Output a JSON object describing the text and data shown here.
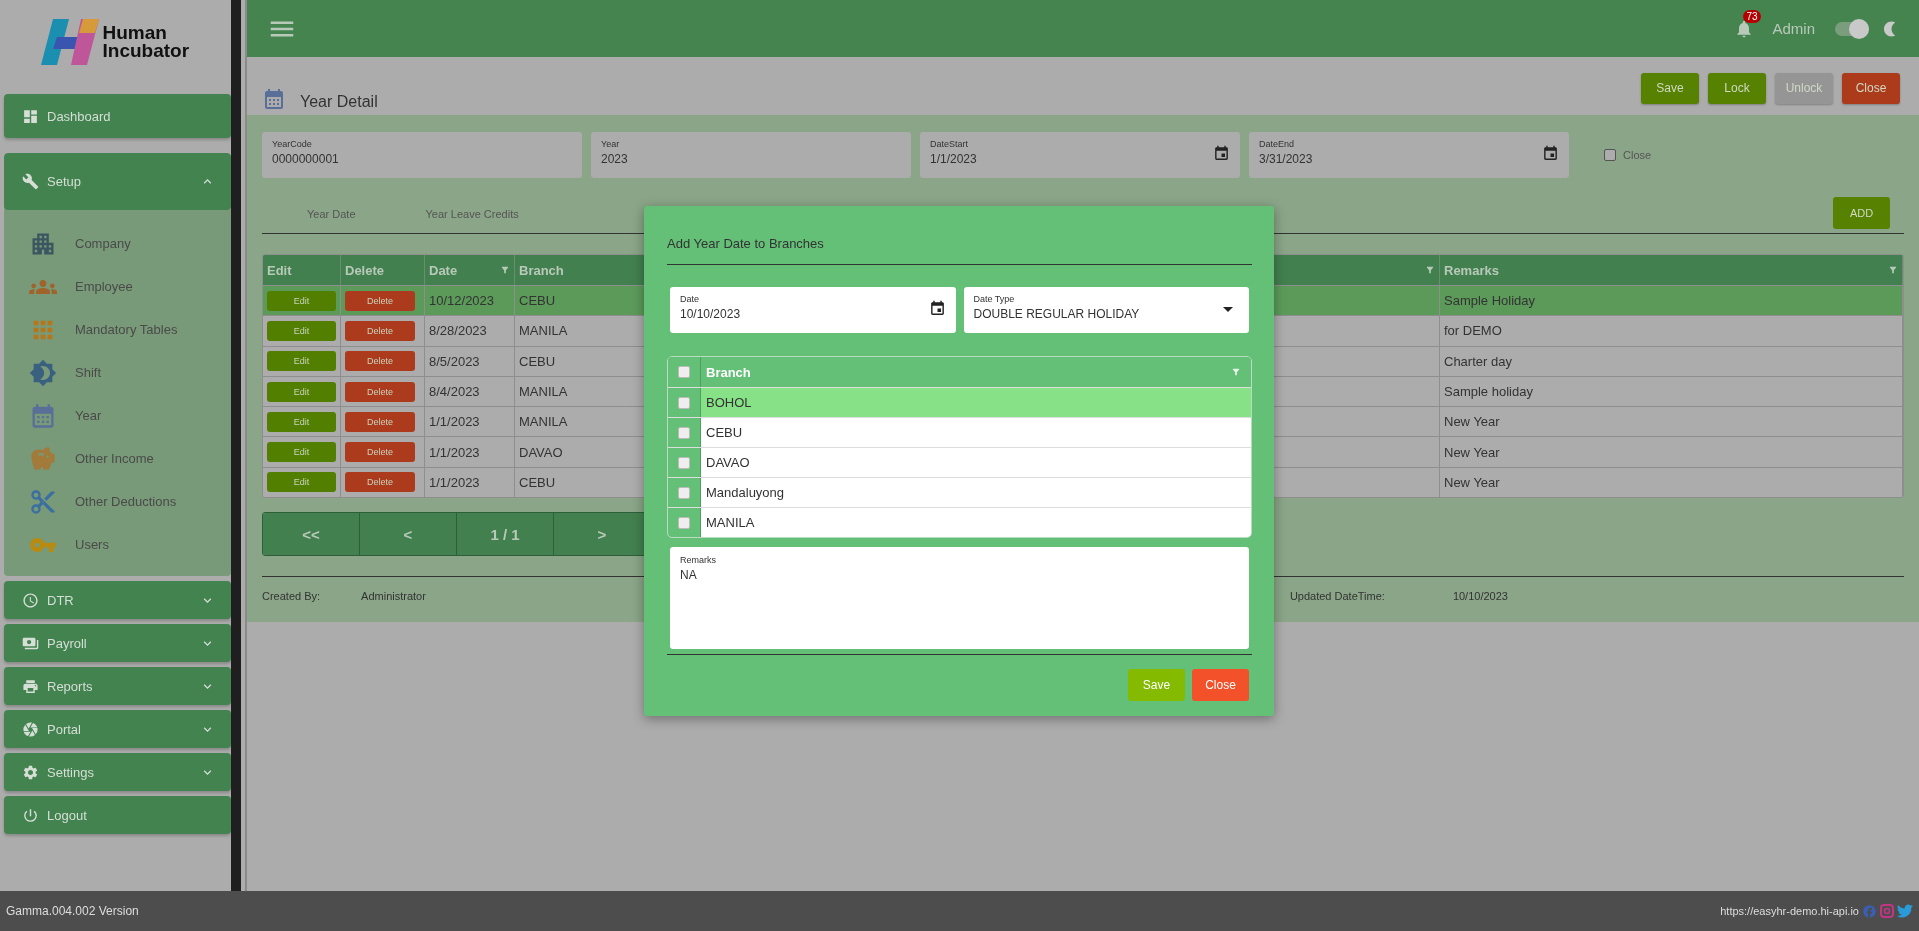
{
  "header": {
    "notification_count": "73",
    "user": "Admin",
    "dark_mode": {
      "on": true
    }
  },
  "sidebar": {
    "logo_text": "Human Incubator",
    "items": [
      {
        "kind": "link",
        "label": "Dashboard"
      },
      {
        "kind": "group",
        "label": "Setup",
        "expanded": true,
        "children": [
          {
            "label": "Company"
          },
          {
            "label": "Employee"
          },
          {
            "label": "Mandatory Tables"
          },
          {
            "label": "Shift"
          },
          {
            "label": "Year"
          },
          {
            "label": "Other Income"
          },
          {
            "label": "Other Deductions"
          },
          {
            "label": "Users"
          }
        ]
      },
      {
        "kind": "group",
        "label": "DTR",
        "expanded": false
      },
      {
        "kind": "group",
        "label": "Payroll",
        "expanded": false
      },
      {
        "kind": "group",
        "label": "Reports",
        "expanded": false
      },
      {
        "kind": "group",
        "label": "Portal",
        "expanded": false
      },
      {
        "kind": "group",
        "label": "Settings",
        "expanded": false
      },
      {
        "kind": "link",
        "label": "Logout"
      }
    ]
  },
  "page": {
    "title": "Year Detail",
    "actions": [
      {
        "label": "Save",
        "kind": "primary",
        "disabled": false
      },
      {
        "label": "Lock",
        "kind": "primary",
        "disabled": false
      },
      {
        "label": "Unlock",
        "kind": "primary",
        "disabled": true
      },
      {
        "label": "Close",
        "kind": "danger",
        "disabled": false
      }
    ],
    "fields": [
      {
        "label": "YearCode",
        "value": "0000000001",
        "kind": "text"
      },
      {
        "label": "Year",
        "value": "2023",
        "kind": "text"
      },
      {
        "label": "DateStart",
        "value": "1/1/2023",
        "kind": "date"
      },
      {
        "label": "DateEnd",
        "value": "3/31/2023",
        "kind": "date"
      }
    ],
    "close_checkbox": {
      "label": "Close",
      "checked": false
    },
    "tabs": [
      {
        "label": "Year Date",
        "selected": false
      },
      {
        "label": "Year Leave Credits",
        "selected": false
      }
    ],
    "add_button": "ADD",
    "table": {
      "columns": [
        {
          "label": "Edit",
          "filter": false
        },
        {
          "label": "Delete",
          "filter": false
        },
        {
          "label": "Date",
          "filter": true
        },
        {
          "label": "Branch",
          "filter": true
        },
        {
          "label": "Remarks",
          "filter": true
        }
      ],
      "rows": [
        {
          "edit": "Edit",
          "delete": "Delete",
          "date": "10/12/2023",
          "branch": "CEBU",
          "remarks": "Sample Holiday",
          "selected": true
        },
        {
          "edit": "Edit",
          "delete": "Delete",
          "date": "8/28/2023",
          "branch": "MANILA",
          "remarks": "for DEMO",
          "selected": false
        },
        {
          "edit": "Edit",
          "delete": "Delete",
          "date": "8/5/2023",
          "branch": "CEBU",
          "remarks": "Charter day",
          "selected": false
        },
        {
          "edit": "Edit",
          "delete": "Delete",
          "date": "8/4/2023",
          "branch": "MANILA",
          "remarks": "Sample holiday",
          "selected": false
        },
        {
          "edit": "Edit",
          "delete": "Delete",
          "date": "1/1/2023",
          "branch": "MANILA",
          "remarks": "New Year",
          "selected": false
        },
        {
          "edit": "Edit",
          "delete": "Delete",
          "date": "1/1/2023",
          "branch": "DAVAO",
          "remarks": "New Year",
          "selected": false
        },
        {
          "edit": "Edit",
          "delete": "Delete",
          "date": "1/1/2023",
          "branch": "CEBU",
          "remarks": "New Year",
          "selected": false
        }
      ]
    },
    "pager": [
      "<<",
      "<",
      "1 / 1",
      ">"
    ],
    "footer": {
      "created_by_label": "Created By:",
      "created_by": "Administrator",
      "updated_label": "Updated DateTime:",
      "updated": "10/10/2023"
    }
  },
  "dialog": {
    "title": "Add Year Date to Branches",
    "date": {
      "label": "Date",
      "value": "10/10/2023"
    },
    "date_type": {
      "label": "Date Type",
      "value": "DOUBLE REGULAR HOLIDAY"
    },
    "branch_table": {
      "header": "Branch",
      "all_checked": false,
      "rows": [
        {
          "name": "BOHOL",
          "checked": false,
          "selected": true
        },
        {
          "name": "CEBU",
          "checked": false,
          "selected": false
        },
        {
          "name": "DAVAO",
          "checked": false,
          "selected": false
        },
        {
          "name": "Mandaluyong",
          "checked": false,
          "selected": false
        },
        {
          "name": "MANILA",
          "checked": false,
          "selected": false
        }
      ]
    },
    "remarks": {
      "label": "Remarks",
      "value": "NA"
    },
    "buttons": [
      {
        "label": "Save",
        "kind": "confirm"
      },
      {
        "label": "Close",
        "kind": "cancel"
      }
    ]
  },
  "status_bar": {
    "version": "Gamma.004.002 Version",
    "url": "https://easyhr-demo.hi-api.io"
  }
}
